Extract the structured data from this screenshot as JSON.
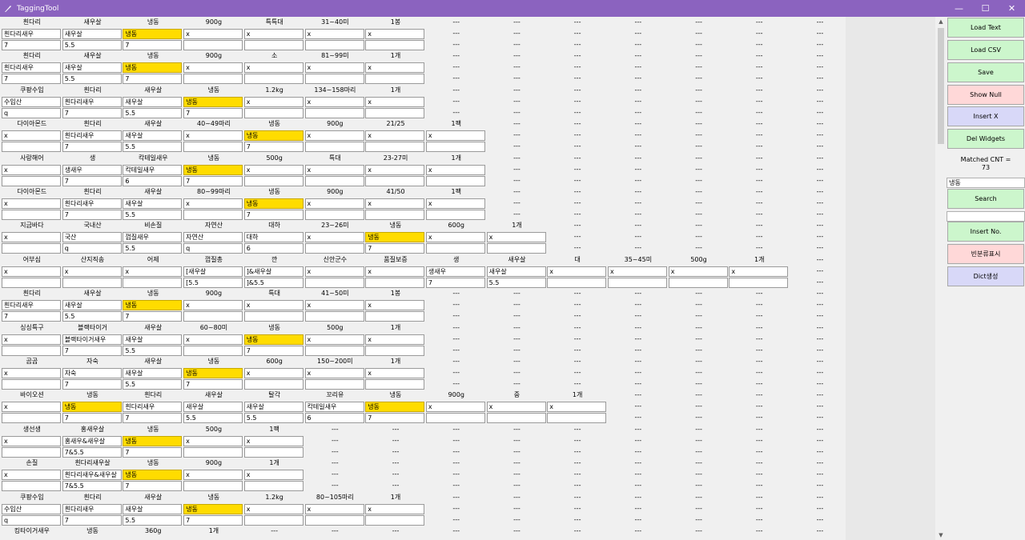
{
  "window": {
    "title": "TaggingTool",
    "app_icon": "feather-pen-icon",
    "controls": {
      "minimize": "—",
      "maximize": "☐",
      "close": "✕"
    }
  },
  "sidebar": {
    "load_text": "Load Text",
    "load_csv": "Load CSV",
    "save": "Save",
    "show_null": "Show Null",
    "insert_x": "Insert X",
    "del_widgets": "Del Widgets",
    "matched_cnt": "Matched CNT =\n73",
    "search_value": "냉동",
    "search": "Search",
    "insert_no_value": "",
    "insert_no": "Insert No.",
    "freq_category": "빈분류표시",
    "dict_gen": "Dict생성"
  },
  "highlight_color": "#ffdc00",
  "groups": [
    {
      "h": [
        "흰다리",
        "새우살",
        "냉동",
        "900g",
        "특특대",
        "31~40미",
        "1봉",
        "---",
        "---",
        "---",
        "---",
        "---",
        "---",
        "---"
      ],
      "a": [
        "흰다리새우",
        "새우살",
        "냉동",
        "x",
        "x",
        "x",
        "x"
      ],
      "b": [
        "7",
        "5.5",
        "7",
        "",
        "",
        "",
        ""
      ]
    },
    {
      "h": [
        "흰다리",
        "새우살",
        "냉동",
        "900g",
        "소",
        "81~99미",
        "1개",
        "---",
        "---",
        "---",
        "---",
        "---",
        "---",
        "---"
      ],
      "a": [
        "흰다리새우",
        "새우살",
        "냉동",
        "x",
        "x",
        "x",
        "x"
      ],
      "b": [
        "7",
        "5.5",
        "7",
        "",
        "",
        "",
        ""
      ]
    },
    {
      "h": [
        "쿠팡수입",
        "흰다리",
        "새우살",
        "냉동",
        "1.2kg",
        "134~158마리",
        "1개",
        "---",
        "---",
        "---",
        "---",
        "---",
        "---",
        "---"
      ],
      "a": [
        "수입산",
        "흰다리새우",
        "새우살",
        "냉동",
        "x",
        "x",
        "x"
      ],
      "b": [
        "q",
        "7",
        "5.5",
        "7",
        "",
        "",
        ""
      ]
    },
    {
      "h": [
        "다이아몬드",
        "흰다리",
        "새우살",
        "40~49마리",
        "냉동",
        "900g",
        "21/25",
        "1팩",
        "---",
        "---",
        "---",
        "---",
        "---",
        "---"
      ],
      "a": [
        "x",
        "흰다리새우",
        "새우살",
        "x",
        "냉동",
        "x",
        "x",
        "x"
      ],
      "b": [
        "",
        "7",
        "5.5",
        "",
        "7",
        "",
        "",
        ""
      ]
    },
    {
      "h": [
        "사랑해어",
        "생",
        "칵테일새우",
        "냉동",
        "500g",
        "특대",
        "23-27미",
        "1개",
        "---",
        "---",
        "---",
        "---",
        "---",
        "---"
      ],
      "a": [
        "x",
        "생새우",
        "칵테일새우",
        "냉동",
        "x",
        "x",
        "x",
        "x"
      ],
      "b": [
        "",
        "7",
        "6",
        "7",
        "",
        "",
        "",
        ""
      ]
    },
    {
      "h": [
        "다이아몬드",
        "흰다리",
        "새우살",
        "80~99마리",
        "냉동",
        "900g",
        "41/50",
        "1팩",
        "---",
        "---",
        "---",
        "---",
        "---",
        "---"
      ],
      "a": [
        "x",
        "흰다리새우",
        "새우살",
        "x",
        "냉동",
        "x",
        "x",
        "x"
      ],
      "b": [
        "",
        "7",
        "5.5",
        "",
        "7",
        "",
        "",
        ""
      ]
    },
    {
      "h": [
        "지금바다",
        "국내산",
        "비손질",
        "자연산",
        "대하",
        "23~26미",
        "냉동",
        "600g",
        "1개",
        "---",
        "---",
        "---",
        "---",
        "---"
      ],
      "a": [
        "x",
        "국산",
        "껍질새우",
        "자연산",
        "대하",
        "x",
        "냉동",
        "x",
        "x"
      ],
      "b": [
        "",
        "q",
        "5.5",
        "q",
        "6",
        "",
        "7",
        "",
        ""
      ]
    },
    {
      "h": [
        "어부심",
        "산지직송",
        "어제",
        "껍질총",
        "깐",
        "신안군수",
        "품질보증",
        "생",
        "새우살",
        "대",
        "35~45미",
        "500g",
        "1개",
        "---"
      ],
      "a": [
        "x",
        "x",
        "x",
        "[새우살",
        "]&새우살",
        "x",
        "x",
        "생새우",
        "새우살",
        "x",
        "x",
        "x",
        "x"
      ],
      "b": [
        "",
        "",
        "",
        "[5.5",
        "]&5.5",
        "",
        "",
        "7",
        "5.5",
        "",
        "",
        "",
        ""
      ]
    },
    {
      "h": [
        "흰다리",
        "새우살",
        "냉동",
        "900g",
        "특대",
        "41~50미",
        "1봉",
        "---",
        "---",
        "---",
        "---",
        "---",
        "---",
        "---"
      ],
      "a": [
        "흰다리새우",
        "새우살",
        "냉동",
        "x",
        "x",
        "x",
        "x"
      ],
      "b": [
        "7",
        "5.5",
        "7",
        "",
        "",
        "",
        ""
      ]
    },
    {
      "h": [
        "싱싱특구",
        "블랙타이거",
        "새우살",
        "60~80미",
        "냉동",
        "500g",
        "1개",
        "---",
        "---",
        "---",
        "---",
        "---",
        "---",
        "---"
      ],
      "a": [
        "x",
        "블랙타이거새우",
        "새우살",
        "x",
        "냉동",
        "x",
        "x"
      ],
      "b": [
        "",
        "7",
        "5.5",
        "",
        "7",
        "",
        ""
      ]
    },
    {
      "h": [
        "곰곰",
        "자숙",
        "새우살",
        "냉동",
        "600g",
        "150~200미",
        "1개",
        "---",
        "---",
        "---",
        "---",
        "---",
        "---",
        "---"
      ],
      "a": [
        "x",
        "자숙",
        "새우살",
        "냉동",
        "x",
        "x",
        "x"
      ],
      "b": [
        "",
        "7",
        "5.5",
        "7",
        "",
        "",
        ""
      ]
    },
    {
      "h": [
        "바이오션",
        "냉동",
        "흰다리",
        "새우살",
        "탈각",
        "꼬리유",
        "냉동",
        "900g",
        "중",
        "1개",
        "---",
        "---",
        "---",
        "---"
      ],
      "a": [
        "x",
        "냉동",
        "흰다리새우",
        "새우살",
        "새우살",
        "칵테일새우",
        "냉동",
        "x",
        "x",
        "x"
      ],
      "b": [
        "",
        "7",
        "7",
        "5.5",
        "5.5",
        "6",
        "7",
        "",
        "",
        ""
      ]
    },
    {
      "h": [
        "생선생",
        "홍새우살",
        "냉동",
        "500g",
        "1팩",
        "---",
        "---",
        "---",
        "---",
        "---",
        "---",
        "---",
        "---",
        "---"
      ],
      "a": [
        "x",
        "홍새우&새우살",
        "냉동",
        "x",
        "x"
      ],
      "b": [
        "",
        "7&5.5",
        "7",
        "",
        ""
      ]
    },
    {
      "h": [
        "손질",
        "흰다리새우살",
        "냉동",
        "900g",
        "1개",
        "---",
        "---",
        "---",
        "---",
        "---",
        "---",
        "---",
        "---",
        "---"
      ],
      "a": [
        "x",
        "흰다리새우&새우살",
        "냉동",
        "x",
        "x"
      ],
      "b": [
        "",
        "7&5.5",
        "7",
        "",
        ""
      ]
    },
    {
      "h": [
        "쿠팡수입",
        "흰다리",
        "새우살",
        "냉동",
        "1.2kg",
        "80~105마리",
        "1개",
        "---",
        "---",
        "---",
        "---",
        "---",
        "---",
        "---"
      ],
      "a": [
        "수입산",
        "흰다리새우",
        "새우살",
        "냉동",
        "x",
        "x",
        "x"
      ],
      "b": [
        "q",
        "7",
        "5.5",
        "7",
        "",
        "",
        ""
      ]
    },
    {
      "h": [
        "킹타이거새우",
        "냉동",
        "360g",
        "1개",
        "---",
        "---",
        "---",
        "---",
        "---",
        "---",
        "---",
        "---",
        "---",
        "---"
      ],
      "a": [],
      "b": []
    }
  ]
}
